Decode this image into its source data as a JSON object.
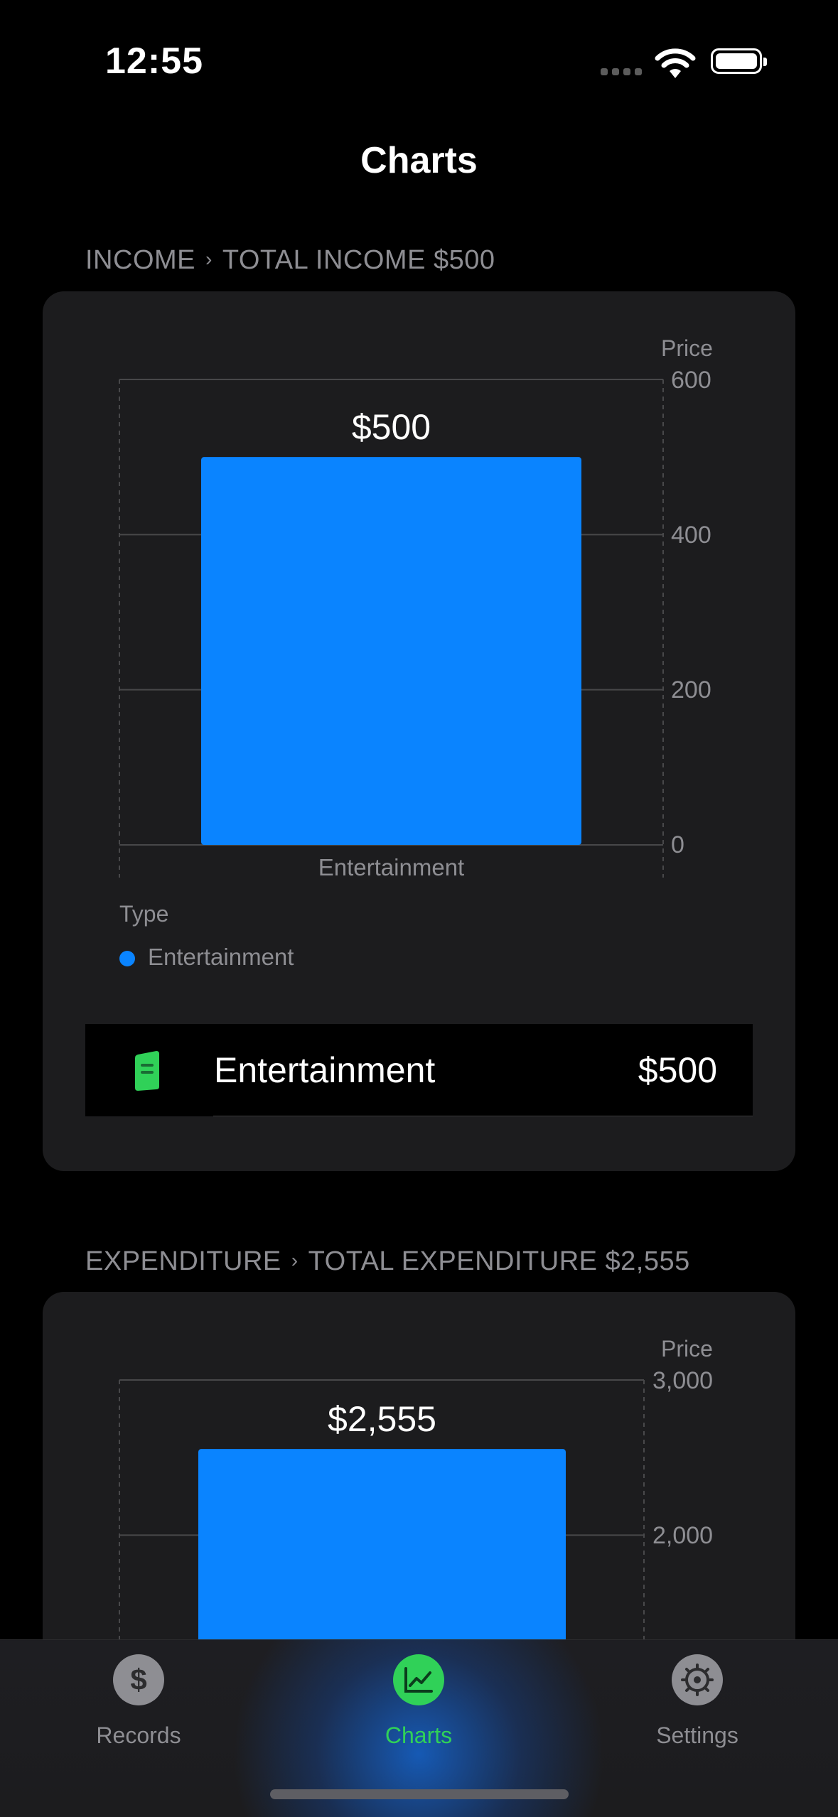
{
  "status": {
    "time": "12:55"
  },
  "nav": {
    "title": "Charts"
  },
  "income": {
    "section": "INCOME",
    "total": "TOTAL INCOME $500",
    "axis_title": "Price",
    "y_ticks": [
      "600",
      "400",
      "200",
      "0"
    ],
    "legend_title": "Type",
    "legend_label": "Entertainment",
    "row": {
      "icon": "document-icon",
      "name": "Entertainment",
      "amount": "$500"
    },
    "chart_data": {
      "type": "bar",
      "categories": [
        "Entertainment"
      ],
      "values": [
        500
      ],
      "value_labels": [
        "$500"
      ],
      "ylabel": "Price",
      "ylim": [
        0,
        600
      ],
      "legend": {
        "title": "Type",
        "entries": [
          "Entertainment"
        ]
      },
      "colors": [
        "#0a84ff"
      ]
    }
  },
  "expenditure": {
    "section": "EXPENDITURE",
    "total": "TOTAL EXPENDITURE $2,555",
    "axis_title": "Price",
    "y_ticks": [
      "3,000",
      "2,000"
    ],
    "chart_data": {
      "type": "bar",
      "categories": [],
      "values": [
        2555
      ],
      "value_labels": [
        "$2,555"
      ],
      "ylabel": "Price",
      "ylim": [
        0,
        3000
      ],
      "colors": [
        "#0a84ff"
      ]
    }
  },
  "tabs": [
    {
      "label": "Records",
      "icon": "dollar-icon",
      "active": false
    },
    {
      "label": "Charts",
      "icon": "chart-icon",
      "active": true
    },
    {
      "label": "Settings",
      "icon": "gear-icon",
      "active": false
    }
  ],
  "colors": {
    "accent": "#0a84ff",
    "active_tab": "#30d158",
    "card": "#1c1c1e"
  }
}
